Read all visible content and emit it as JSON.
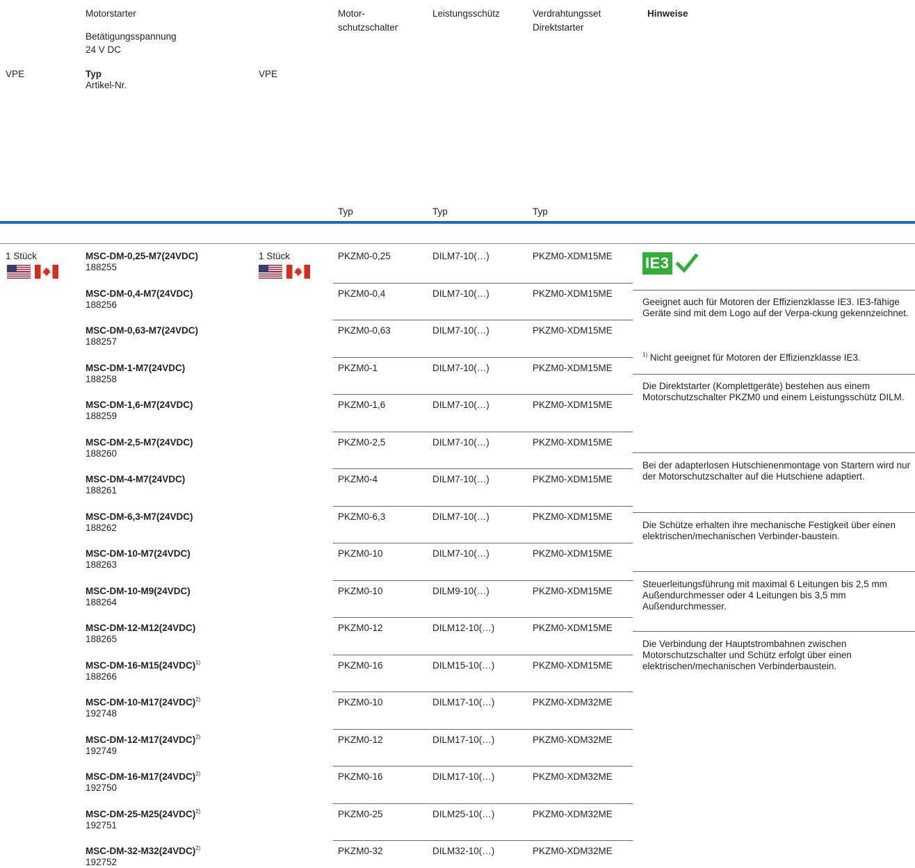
{
  "header": {
    "motorstarter": "Motorstarter",
    "voltage_label": "Betätigungsspannung",
    "voltage_value": "24 V DC",
    "col_motor_1": "Motor-",
    "col_motor_2": "schutzschalter",
    "col_contactor": "Leistungsschütz",
    "col_wiring_1": "Verdrahtungsset",
    "col_wiring_2": "Direktstarter",
    "col_notes": "Hinweise",
    "vpe_left": "VPE",
    "typ_label": "Typ",
    "article_label": "Artikel-Nr.",
    "vpe_right": "VPE",
    "typ_motor": "Typ",
    "typ_contactor": "Typ",
    "typ_wiring": "Typ"
  },
  "packaging": {
    "left_qty": "1 Stück",
    "right_qty": "1 Stück"
  },
  "rows": [
    {
      "type": "MSC-DM-0,25-M7(24VDC)",
      "sup": "",
      "article": "188255",
      "motor": "PKZM0-0,25",
      "contactor": "DILM7-10(…)",
      "wiring": "PKZM0-XDM15ME"
    },
    {
      "type": "MSC-DM-0,4-M7(24VDC)",
      "sup": "",
      "article": "188256",
      "motor": "PKZM0-0,4",
      "contactor": "DILM7-10(…)",
      "wiring": "PKZM0-XDM15ME"
    },
    {
      "type": "MSC-DM-0,63-M7(24VDC)",
      "sup": "",
      "article": "188257",
      "motor": "PKZM0-0,63",
      "contactor": "DILM7-10(…)",
      "wiring": "PKZM0-XDM15ME"
    },
    {
      "type": "MSC-DM-1-M7(24VDC)",
      "sup": "",
      "article": "188258",
      "motor": "PKZM0-1",
      "contactor": "DILM7-10(…)",
      "wiring": "PKZM0-XDM15ME"
    },
    {
      "type": "MSC-DM-1,6-M7(24VDC)",
      "sup": "",
      "article": "188259",
      "motor": "PKZM0-1,6",
      "contactor": "DILM7-10(…)",
      "wiring": "PKZM0-XDM15ME"
    },
    {
      "type": "MSC-DM-2,5-M7(24VDC)",
      "sup": "",
      "article": "188260",
      "motor": "PKZM0-2,5",
      "contactor": "DILM7-10(…)",
      "wiring": "PKZM0-XDM15ME"
    },
    {
      "type": "MSC-DM-4-M7(24VDC)",
      "sup": "",
      "article": "188261",
      "motor": "PKZM0-4",
      "contactor": "DILM7-10(…)",
      "wiring": "PKZM0-XDM15ME"
    },
    {
      "type": "MSC-DM-6,3-M7(24VDC)",
      "sup": "",
      "article": "188262",
      "motor": "PKZM0-6,3",
      "contactor": "DILM7-10(…)",
      "wiring": "PKZM0-XDM15ME"
    },
    {
      "type": "MSC-DM-10-M7(24VDC)",
      "sup": "",
      "article": "188263",
      "motor": "PKZM0-10",
      "contactor": "DILM7-10(…)",
      "wiring": "PKZM0-XDM15ME"
    },
    {
      "type": "MSC-DM-10-M9(24VDC)",
      "sup": "",
      "article": "188264",
      "motor": "PKZM0-10",
      "contactor": "DILM9-10(…)",
      "wiring": "PKZM0-XDM15ME"
    },
    {
      "type": "MSC-DM-12-M12(24VDC)",
      "sup": "",
      "article": "188265",
      "motor": "PKZM0-12",
      "contactor": "DILM12-10(…)",
      "wiring": "PKZM0-XDM15ME"
    },
    {
      "type": "MSC-DM-16-M15(24VDC)",
      "sup": "1)",
      "article": "188266",
      "motor": "PKZM0-16",
      "contactor": "DILM15-10(…)",
      "wiring": "PKZM0-XDM15ME"
    },
    {
      "type": "MSC-DM-10-M17(24VDC)",
      "sup": "2)",
      "article": "192748",
      "motor": "PKZM0-10",
      "contactor": "DILM17-10(…)",
      "wiring": "PKZM0-XDM32ME"
    },
    {
      "type": "MSC-DM-12-M17(24VDC)",
      "sup": "2)",
      "article": "192749",
      "motor": "PKZM0-12",
      "contactor": "DILM17-10(…)",
      "wiring": "PKZM0-XDM32ME"
    },
    {
      "type": "MSC-DM-16-M17(24VDC)",
      "sup": "2)",
      "article": "192750",
      "motor": "PKZM0-16",
      "contactor": "DILM17-10(…)",
      "wiring": "PKZM0-XDM32ME"
    },
    {
      "type": "MSC-DM-25-M25(24VDC)",
      "sup": "2)",
      "article": "192751",
      "motor": "PKZM0-25",
      "contactor": "DILM25-10(…)",
      "wiring": "PKZM0-XDM32ME"
    },
    {
      "type": "MSC-DM-32-M32(24VDC)",
      "sup": "2)",
      "article": "192752",
      "motor": "PKZM0-32",
      "contactor": "DILM32-10(…)",
      "wiring": "PKZM0-XDM32ME"
    }
  ],
  "notes": {
    "ie3_logo": "IE3",
    "ie3_text": "Geeignet auch für Motoren der Effizienzklasse IE3. IE3-fähige Geräte sind mit dem Logo auf der Verpa-ckung gekennzeichnet.",
    "footnote_sup": "1)",
    "footnote_text": "Nicht geeignet für Motoren der Effizienzklasse IE3.",
    "note1": "Die Direktstarter (Komplettgeräte) bestehen aus einem Motorschutzschalter PKZM0 und einem Leistungsschütz DILM.",
    "note2": "Bei der adapterlosen Hutschienenmontage von Startern wird nur der Motorschutzschalter auf die Hutschiene adaptiert.",
    "note3": "Die Schütze erhalten ihre mechanische Festigkeit über einen elektrischen/mechanischen Verbinder-baustein.",
    "note4": "Steuerleitungsführung mit maximal 6 Leitungen bis 2,5 mm Außendurchmesser oder 4 Leitungen bis 3,5 mm Außendurchmesser.",
    "note5": "Die Verbindung der Hauptstrombahnen zwischen Motorschutzschalter und Schütz erfolgt über einen elektrischen/mechanischen Verbinderbaustein."
  },
  "colors": {
    "accent_bar": "#1f6ea8",
    "ie3_green": "#2fae38"
  },
  "icons": [
    "flag-us-icon",
    "flag-ca-icon",
    "ie3-logo",
    "checkmark-icon"
  ]
}
